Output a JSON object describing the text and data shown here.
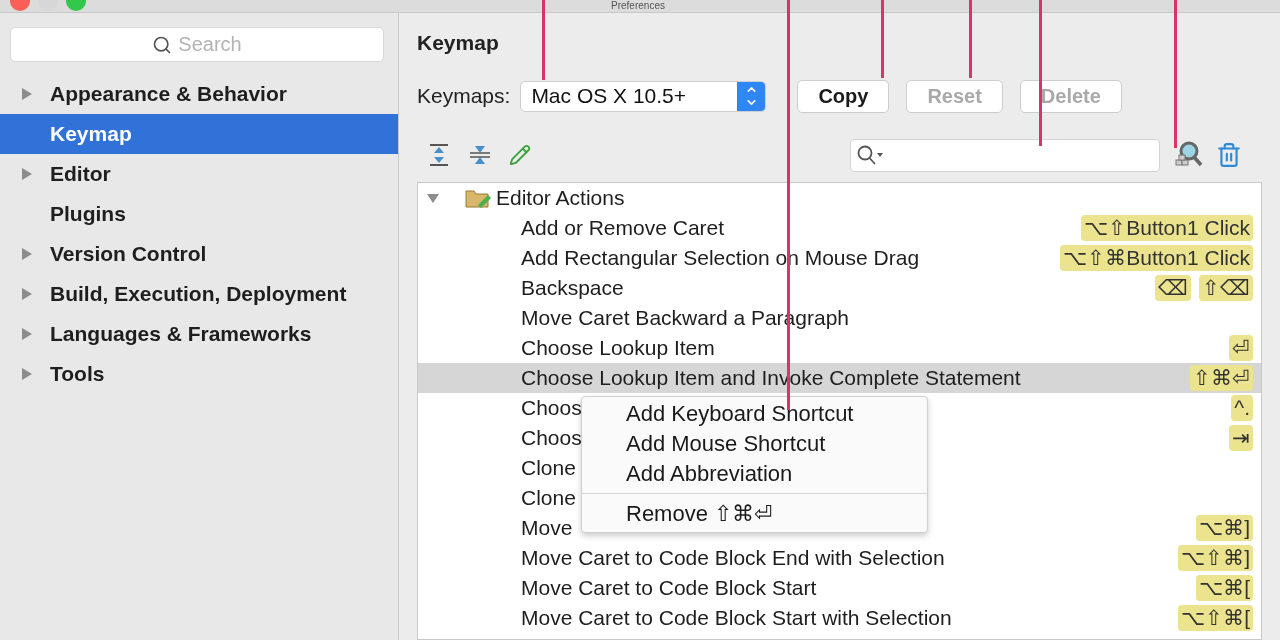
{
  "window": {
    "title": "Preferences"
  },
  "sidebar": {
    "search": {
      "placeholder": "Search"
    },
    "items": [
      {
        "label": "Appearance & Behavior",
        "expandable": true,
        "selected": false
      },
      {
        "label": "Keymap",
        "expandable": false,
        "selected": true
      },
      {
        "label": "Editor",
        "expandable": true,
        "selected": false
      },
      {
        "label": "Plugins",
        "expandable": false,
        "selected": false
      },
      {
        "label": "Version Control",
        "expandable": true,
        "selected": false
      },
      {
        "label": "Build, Execution, Deployment",
        "expandable": true,
        "selected": false
      },
      {
        "label": "Languages & Frameworks",
        "expandable": true,
        "selected": false
      },
      {
        "label": "Tools",
        "expandable": true,
        "selected": false
      }
    ]
  },
  "main": {
    "title": "Keymap",
    "keymaps_label": "Keymaps:",
    "keymaps_value": "Mac OS X 10.5+",
    "buttons": [
      {
        "label": "Copy",
        "disabled": false
      },
      {
        "label": "Reset",
        "disabled": true
      },
      {
        "label": "Delete",
        "disabled": true
      }
    ]
  },
  "tree": {
    "group": {
      "label": "Editor Actions",
      "expanded": true
    },
    "rows": [
      {
        "label": "Add or Remove Caret",
        "shortcuts": [
          "⌥⇧Button1 Click"
        ],
        "selected": false
      },
      {
        "label": "Add Rectangular Selection on Mouse Drag",
        "shortcuts": [
          "⌥⇧⌘Button1 Click"
        ],
        "selected": false
      },
      {
        "label": "Backspace",
        "shortcuts": [
          "⌫",
          "⇧⌫"
        ],
        "selected": false
      },
      {
        "label": "Move Caret Backward a Paragraph",
        "shortcuts": [],
        "selected": false
      },
      {
        "label": "Choose Lookup Item",
        "shortcuts": [
          "⏎"
        ],
        "selected": false
      },
      {
        "label": "Choose Lookup Item and Invoke Complete Statement",
        "shortcuts": [
          "⇧⌘⏎"
        ],
        "selected": true
      },
      {
        "label": "Choos",
        "shortcuts": [
          "^."
        ],
        "selected": false
      },
      {
        "label": "Choos",
        "shortcuts": [
          "⇥"
        ],
        "selected": false
      },
      {
        "label": "Clone",
        "shortcuts": [],
        "selected": false
      },
      {
        "label": "Clone",
        "shortcuts": [],
        "selected": false
      },
      {
        "label": "Move",
        "shortcuts": [
          "⌥⌘]"
        ],
        "selected": false
      },
      {
        "label": "Move Caret to Code Block End with Selection",
        "shortcuts": [
          "⌥⇧⌘]"
        ],
        "selected": false
      },
      {
        "label": "Move Caret to Code Block Start",
        "shortcuts": [
          "⌥⌘["
        ],
        "selected": false
      },
      {
        "label": "Move Caret to Code Block Start with Selection",
        "shortcuts": [
          "⌥⇧⌘["
        ],
        "selected": false
      }
    ]
  },
  "context_menu": {
    "items": [
      {
        "kind": "item",
        "label": "Add Keyboard Shortcut"
      },
      {
        "kind": "item",
        "label": "Add Mouse Shortcut"
      },
      {
        "kind": "item",
        "label": "Add Abbreviation"
      },
      {
        "kind": "separator"
      },
      {
        "kind": "item",
        "label": "Remove ⇧⌘⏎"
      }
    ]
  }
}
